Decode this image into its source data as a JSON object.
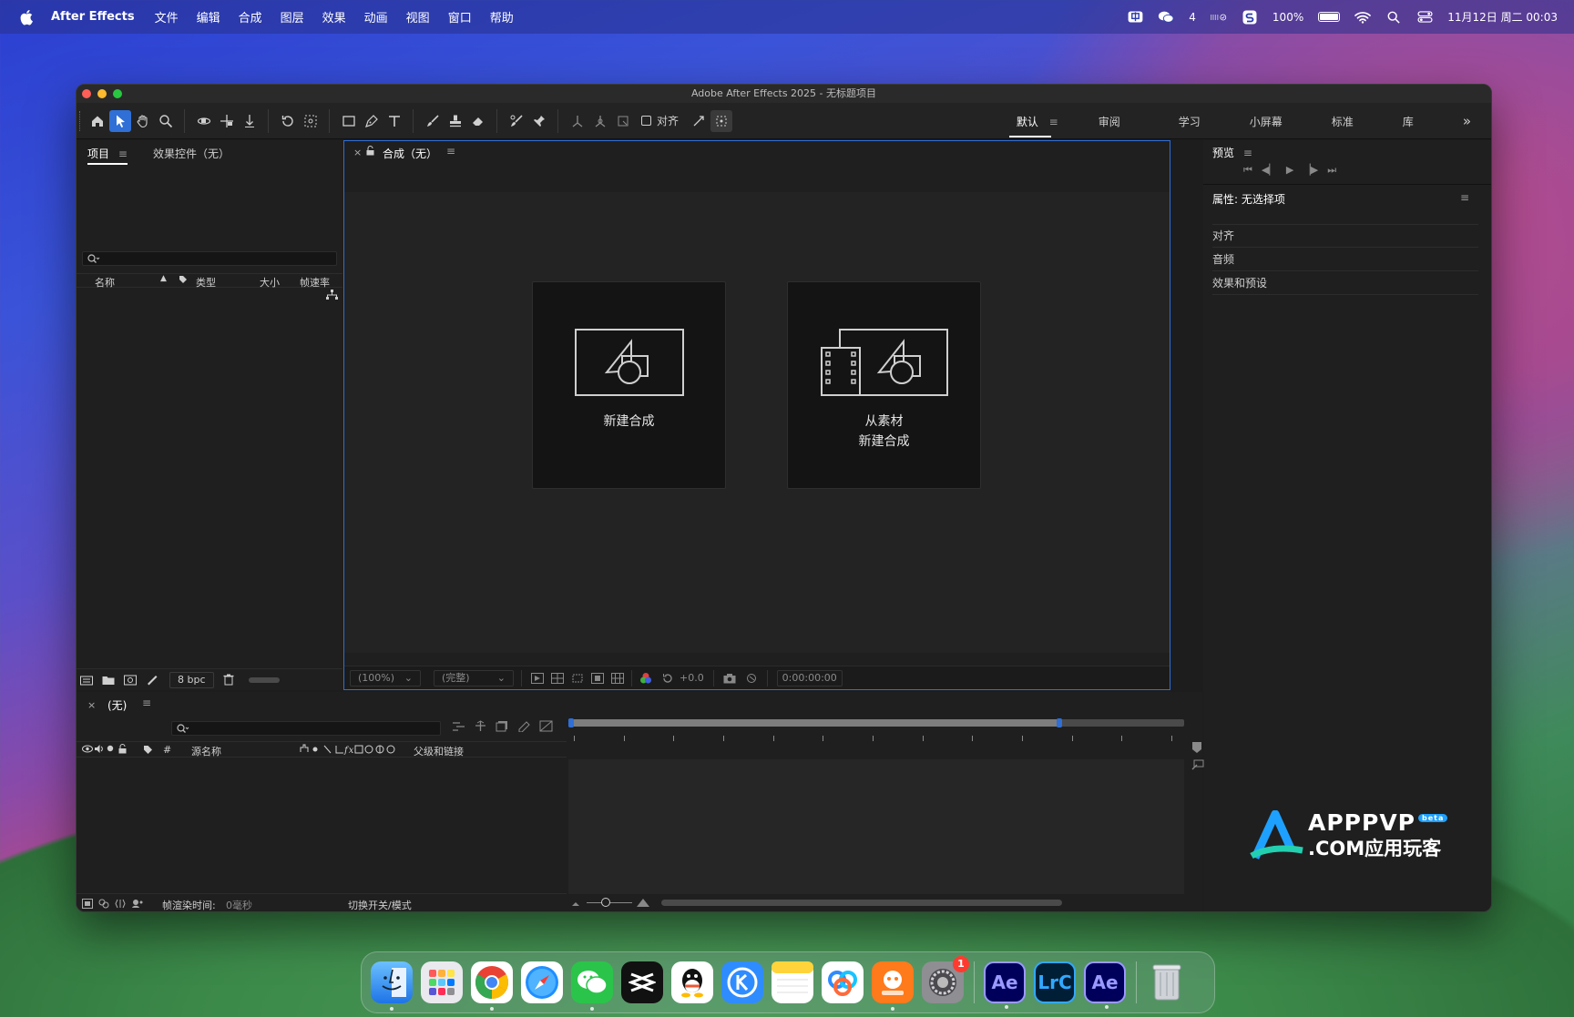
{
  "menubar": {
    "app_name": "After Effects",
    "menus": [
      "文件",
      "编辑",
      "合成",
      "图层",
      "效果",
      "动画",
      "视图",
      "窗口",
      "帮助"
    ],
    "wechat_count": "4",
    "battery": "100%",
    "datetime": "11月12日 周二 00:03"
  },
  "window": {
    "title": "Adobe After Effects 2025 - 无标题项目"
  },
  "toolbar": {
    "align_label": "对齐",
    "workspaces": [
      "默认",
      "审阅",
      "学习",
      "小屏幕",
      "标准",
      "库"
    ],
    "overflow": "»"
  },
  "project_panel": {
    "tab_project": "项目",
    "tab_effects": "效果控件（无）",
    "columns": [
      "名称",
      "类型",
      "大小",
      "帧速率"
    ],
    "bpc": "8 bpc"
  },
  "composition_panel": {
    "tab_label": "合成（无）",
    "close": "×",
    "new_comp_label": "新建合成",
    "from_footage_line1": "从素材",
    "from_footage_line2": "新建合成",
    "zoom": "(100%)",
    "resolution": "(完整)",
    "exposure": "+0.0",
    "timecode": "0:00:00:00"
  },
  "right_panel": {
    "preview_title": "预览",
    "properties_title": "属性: 无选择项",
    "rows": [
      "对齐",
      "音频",
      "效果和预设"
    ]
  },
  "timeline": {
    "close": "×",
    "tab_label": "(无)",
    "source_name": "源名称",
    "hash": "#",
    "parent_link": "父级和链接",
    "render_time_label": "帧渲染时间:",
    "render_time_value": "0毫秒",
    "toggle_label": "切换开关/模式"
  },
  "watermark": {
    "line1": "APPPVP",
    "badge": "beta",
    "line2": ".COM应用玩客"
  },
  "dock": {
    "notification_badge": "1",
    "apps": [
      "Finder",
      "Launchpad",
      "Chrome",
      "Safari",
      "WeChat",
      "CapCut",
      "QQ",
      "Kuaishou",
      "Notes",
      "Baidu",
      "Taobao",
      "Settings",
      "Ae",
      "LrC",
      "Ae",
      "Trash"
    ]
  },
  "colors": {
    "accent": "#2f6fd6",
    "panel": "#1f1f1f",
    "window": "#1d1d1d"
  }
}
